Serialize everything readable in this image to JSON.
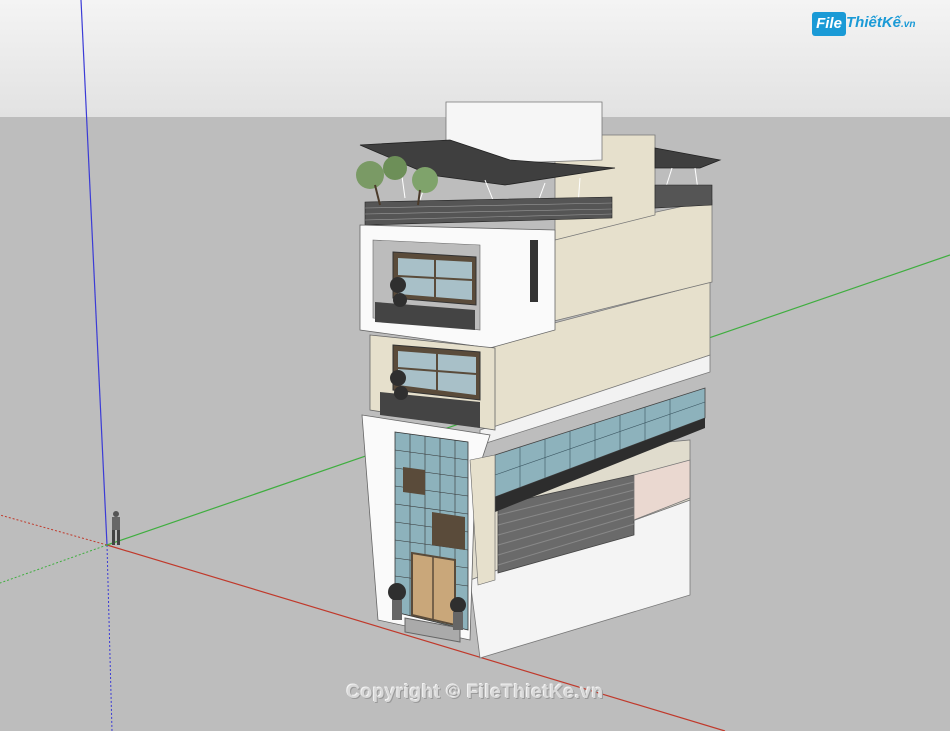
{
  "app": {
    "kind": "sketchup-3d-viewport"
  },
  "watermark": {
    "logo_badge": "File",
    "logo_text": "ThiếtKế",
    "logo_tld": ".vn",
    "copyright": "Copyright © FileThietKe.vn"
  },
  "colors": {
    "sky": "#e9e9e9",
    "ground": "#bdbdbd",
    "axis_red": "#c0392b",
    "axis_green": "#3fae3f",
    "axis_blue": "#3b3bd6",
    "wall_white": "#f7f7f7",
    "wall_beige": "#e6e0cc",
    "roof": "#3f3f3f",
    "glass": "#7fa3ad",
    "brand": "#1a9ad6"
  },
  "icons": [
    "person-scale-figure-icon",
    "tree-icon",
    "plant-icon"
  ]
}
